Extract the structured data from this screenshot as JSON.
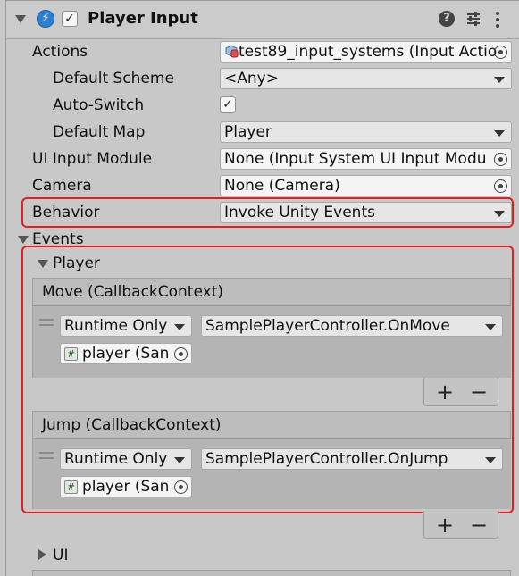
{
  "component": {
    "title": "Player Input",
    "enabled_check": "✓"
  },
  "properties": {
    "actions": {
      "label": "Actions",
      "value": "test89_input_systems (Input Actio"
    },
    "default_scheme": {
      "label": "Default Scheme",
      "value": "<Any>"
    },
    "auto_switch": {
      "label": "Auto-Switch",
      "check": "✓"
    },
    "default_map": {
      "label": "Default Map",
      "value": "Player"
    },
    "ui_input_module": {
      "label": "UI Input Module",
      "value": "None (Input System UI Input Modu"
    },
    "camera": {
      "label": "Camera",
      "value": "None (Camera)"
    },
    "behavior": {
      "label": "Behavior",
      "value": "Invoke Unity Events"
    }
  },
  "events": {
    "label": "Events",
    "player_group": "Player",
    "ui_group": "UI",
    "move": {
      "title": "Move (CallbackContext)",
      "runtime": "Runtime Only",
      "function": "SamplePlayerController.OnMove",
      "target": "player (San"
    },
    "jump": {
      "title": "Jump (CallbackContext)",
      "runtime": "Runtime Only",
      "function": "SamplePlayerController.OnJump",
      "target": "player (San"
    },
    "add_label": "+",
    "remove_label": "−",
    "hash_glyph": "#"
  },
  "colors": {
    "highlight_box": "#e02020",
    "panel_bg": "#c8c8c8"
  }
}
